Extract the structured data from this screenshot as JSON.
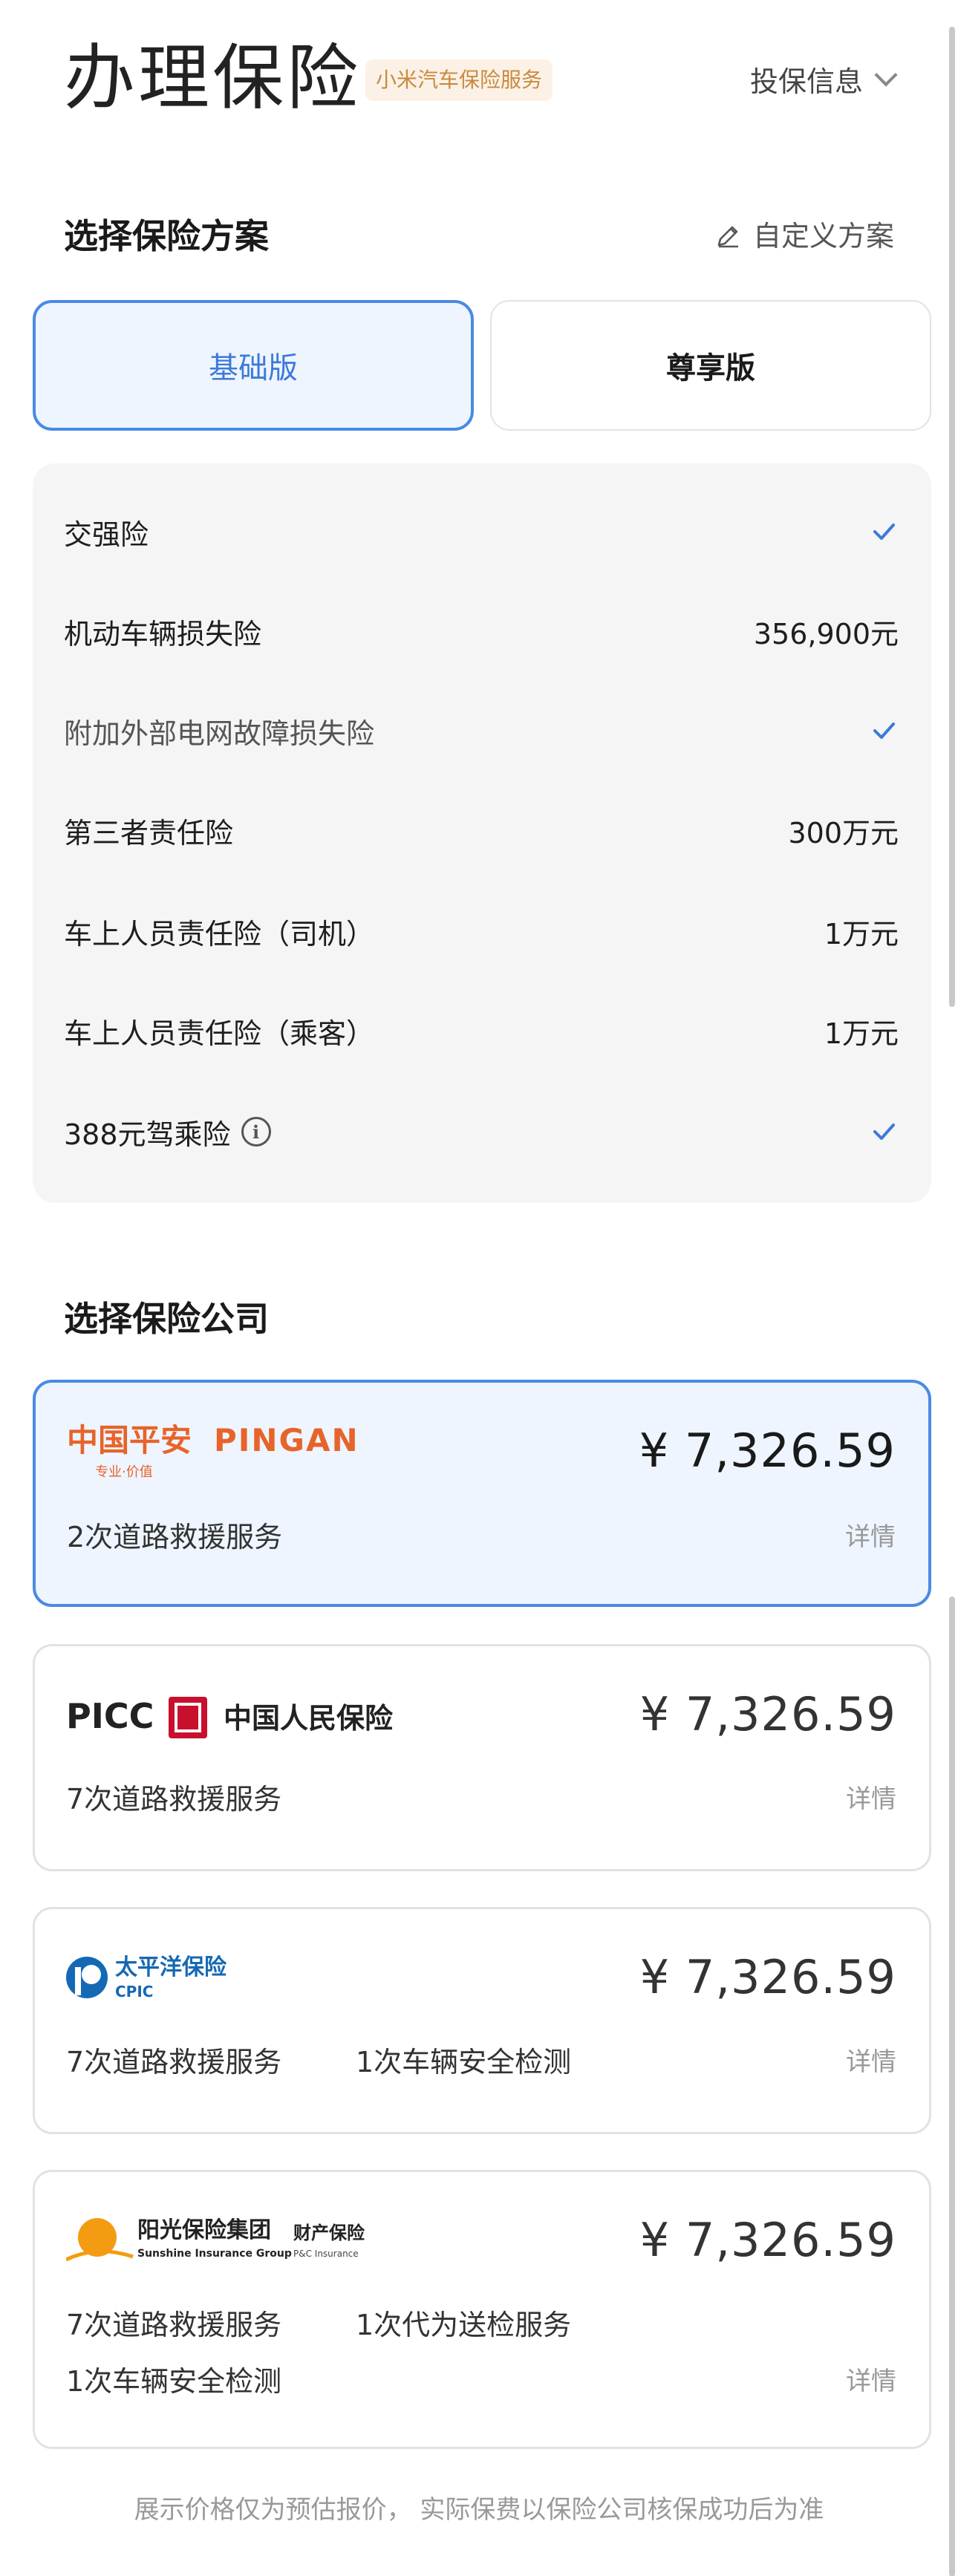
{
  "header": {
    "title": "办理保险",
    "tag": "小米汽车保险服务",
    "insure_info": "投保信息"
  },
  "plan_section": {
    "title": "选择保险方案",
    "custom_plan": "自定义方案",
    "tabs": [
      {
        "label": "基础版",
        "selected": true
      },
      {
        "label": "尊享版",
        "selected": false
      }
    ]
  },
  "coverage": {
    "items": [
      {
        "label": "交强险",
        "value": "",
        "checked": true
      },
      {
        "label": "机动车辆损失险",
        "value": "356,900元",
        "checked": false
      },
      {
        "label": "附加外部电网故障损失险",
        "value": "",
        "checked": true
      },
      {
        "label": "第三者责任险",
        "value": "300万元",
        "checked": false
      },
      {
        "label": "车上人员责任险（司机）",
        "value": "1万元",
        "checked": false
      },
      {
        "label": "车上人员责任险（乘客）",
        "value": "1万元",
        "checked": false
      },
      {
        "label": "388元驾乘险",
        "value": "",
        "checked": true
      }
    ]
  },
  "company_section": {
    "title": "选择保险公司",
    "companies": [
      {
        "logo_text": "中国平安",
        "logo_text_en": "PINGAN",
        "logo_sub": "专业·价值",
        "price": "¥ 7,326.59",
        "services": [
          "2次道路救援服务"
        ],
        "detail": "详情",
        "selected": true
      },
      {
        "logo_text": "PICC",
        "logo_text_cn": "中国人民保险",
        "price": "¥ 7,326.59",
        "services": [
          "7次道路救援服务"
        ],
        "detail": "详情",
        "selected": false
      },
      {
        "logo_text": "太平洋保险",
        "logo_text_en": "CPIC",
        "price": "¥ 7,326.59",
        "services": [
          "7次道路救援服务",
          "1次车辆安全检测"
        ],
        "detail": "详情",
        "selected": false
      },
      {
        "logo_text": "阳光保险集团",
        "logo_text_en": "Sunshine Insurance Group",
        "logo_badge": "财产保险",
        "logo_badge_en": "P&C Insurance",
        "price": "¥ 7,326.59",
        "services": [
          "7次道路救援服务",
          "1次代为送检服务",
          "1次车辆安全检测"
        ],
        "detail": "详情",
        "selected": false
      }
    ]
  },
  "footer": {
    "note": "展示价格仅为预估报价，  实际保费以保险公司核保成功后为准"
  },
  "colors": {
    "accent": "#4a8ae3",
    "selected_bg": "#eef5ff",
    "pingan_orange": "#e8632a",
    "picc_red": "#c8102e",
    "cpic_blue": "#1569b4",
    "sunshine_orange": "#f39c12"
  }
}
